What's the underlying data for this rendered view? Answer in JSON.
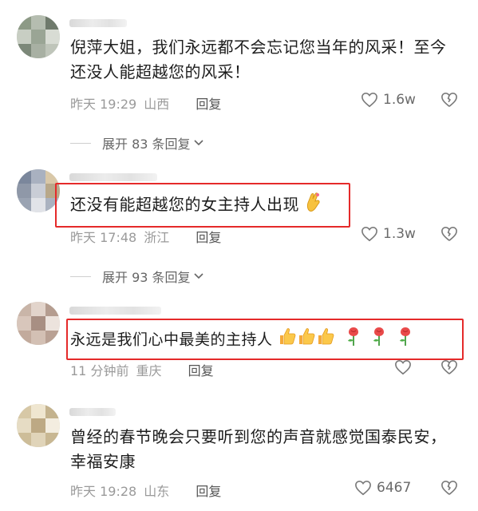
{
  "comments": [
    {
      "text": "倪萍大姐，我们永远都不会忘记您当年的风采！至今还没人能超越您的风采！",
      "time": "昨天 19:29",
      "location": "山西",
      "reply_label": "回复",
      "likes": "1.6w",
      "expand_label": "展开 83 条回复",
      "avatar_colors": [
        "#8d9a86",
        "#b5bdb0",
        "#6f7a6c",
        "#c8cec3",
        "#9aa595",
        "#d8dcd4",
        "#7c8879",
        "#a8b0a3",
        "#bfc5ba"
      ]
    },
    {
      "text": "还没有能超越您的女主持人出现",
      "time": "昨天 17:48",
      "location": "浙江",
      "reply_label": "回复",
      "likes": "1.3w",
      "expand_label": "展开 93 条回复",
      "emoji_icons": [
        "crossed-fingers-icon"
      ],
      "avatar_colors": [
        "#7b879c",
        "#a9b1c0",
        "#d9c8a8",
        "#8f98a8",
        "#c9cdd6",
        "#b8a88a",
        "#9aa3b2",
        "#e1e3e8",
        "#aab2c0"
      ]
    },
    {
      "text": "永远是我们心中最美的主持人",
      "time": "11 分钟前",
      "location": "重庆",
      "reply_label": "回复",
      "likes": "",
      "emoji_icons": [
        "thumbs-up-icon",
        "thumbs-up-icon",
        "thumbs-up-icon",
        "rose-icon",
        "rose-icon",
        "rose-icon"
      ],
      "avatar_colors": [
        "#c9b5a8",
        "#e2d4cb",
        "#b59d90",
        "#d8c6bb",
        "#a88f83",
        "#ece3dd",
        "#c2aa9c",
        "#d3c0b4",
        "#b9a194"
      ]
    },
    {
      "text": "曾经的春节晚会只要听到您的声音就感觉国泰民安，幸福安康",
      "time": "昨天 19:28",
      "location": "山东",
      "reply_label": "回复",
      "likes": "6467",
      "avatar_colors": [
        "#d7c8a6",
        "#efe6d0",
        "#c4b38e",
        "#e6dcc4",
        "#bda984",
        "#f3ede0",
        "#cdbd99",
        "#e0d4b9",
        "#c8b792"
      ]
    }
  ],
  "colors": {
    "highlight": "#e52a2a",
    "meta_text": "#9a9a9a",
    "body_text": "#1d1d1d"
  }
}
